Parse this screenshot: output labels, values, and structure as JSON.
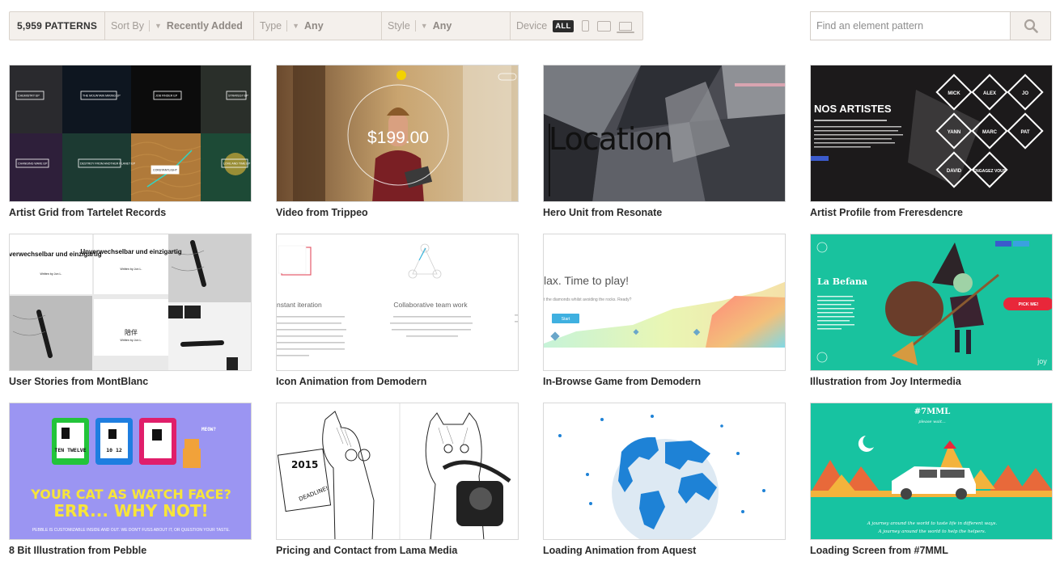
{
  "filters": {
    "pattern_count": "5,959 PATTERNS",
    "sort_label": "Sort By",
    "sort_value": "Recently Added",
    "type_label": "Type",
    "type_value": "Any",
    "style_label": "Style",
    "style_value": "Any",
    "device_label": "Device",
    "device_all": "ALL",
    "device_icons": [
      "phone-icon",
      "tablet-icon",
      "laptop-icon"
    ]
  },
  "search": {
    "placeholder": "Find an element pattern",
    "icon": "search-icon"
  },
  "patterns": [
    {
      "title": "Artist Grid from Tartelet Records"
    },
    {
      "title": "Video from Trippeo"
    },
    {
      "title": "Hero Unit from Resonate"
    },
    {
      "title": "Artist Profile from Freresdencre"
    },
    {
      "title": "User Stories from MontBlanc"
    },
    {
      "title": "Icon Animation from Demodern"
    },
    {
      "title": "In-Browse Game from Demodern"
    },
    {
      "title": "Illustration from Joy Intermedia"
    },
    {
      "title": "8 Bit Illustration from Pebble"
    },
    {
      "title": "Pricing and Contact from Lama Media"
    },
    {
      "title": "Loading Animation from Aquest"
    },
    {
      "title": "Loading Screen from #7MML"
    }
  ],
  "thumb_text": {
    "artist_grid": [
      "CHEMISTRY EP",
      "THE MOUNTAIN MIKING EP",
      "JOB FINDER EP",
      "STRATEGY EP",
      "CHANGING WAVE EP",
      "DESTROY FROM ANOTHER PLANET EP",
      "CONSTANTLIGHT",
      "LOVE AND TIME EP"
    ],
    "trippeo_price": "$199.00",
    "resonate_word": "Location",
    "freres_heading": "NOS ARTISTES",
    "freres_names": [
      "MICK",
      "ALEX",
      "JO",
      "YANN",
      "MARC",
      "PAT",
      "DAVID",
      "ENGAGEZ VOUS"
    ],
    "montblanc_heading": "Unverwechselbar und einzigartig",
    "montblanc_byline": "Written by Jon L.",
    "montblanc_chinese": "陪伴",
    "demodern_left": "nstant iteration",
    "demodern_right": "Collaborative team work",
    "game_heading": "lax. Time to play!",
    "game_sub": "t the diamonds whilst avoiding the rocks. Ready?",
    "game_button": "Start",
    "joy_heading": "La Befana",
    "joy_pick": "PICK ME!",
    "joy_logo": "joy",
    "pebble_watch_text": [
      "TEN TWELVE",
      "10 12",
      ""
    ],
    "pebble_meow": "MEOW?",
    "pebble_headline_1": "YOUR CAT AS WATCH FACE?",
    "pebble_headline_2": "ERR... WHY NOT!",
    "pebble_sub": "PEBBLE IS CUSTOMIZABLE INSIDE AND OUT. WE DON'T FUSS ABOUT IT, OR QUESTION YOUR TASTE.",
    "lama_year": "2015",
    "lama_deadline": "DEADLINE!",
    "mml_title": "#7MML",
    "mml_sub": "please wait...",
    "mml_caption_1": "A journey around the world to taste life in different ways.",
    "mml_caption_2": "A journey around the world to help the helpers."
  },
  "colors": {
    "bar_bg": "#f4f0ec",
    "accent_teal": "#17c3a1",
    "pebble_purple": "#9b95f2",
    "pebble_yellow": "#f7e53a",
    "aquest_blue": "#1e82d6"
  }
}
